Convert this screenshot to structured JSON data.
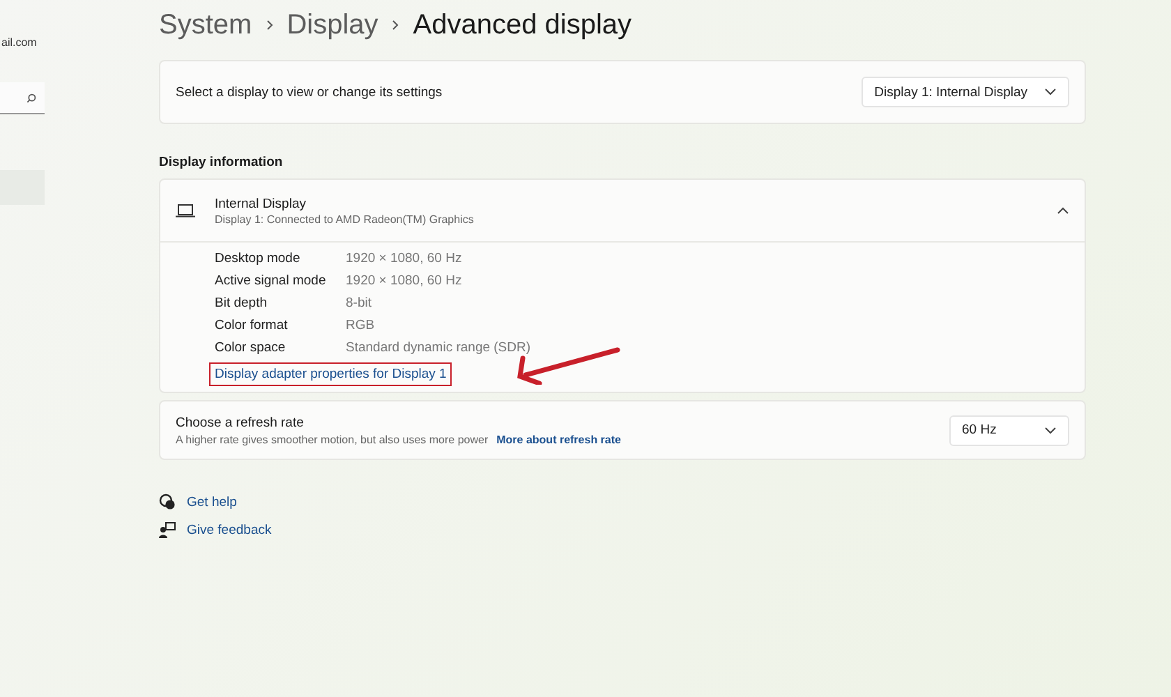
{
  "sidebar": {
    "account_email": "ail.com",
    "items": [
      {
        "selected": true
      }
    ]
  },
  "breadcrumb": [
    "System",
    "Display",
    "Advanced display"
  ],
  "display_select": {
    "label": "Select a display to view or change its settings",
    "value": "Display 1: Internal Display"
  },
  "section_title": "Display information",
  "display_card": {
    "title": "Internal Display",
    "subtitle": "Display 1: Connected to AMD Radeon(TM) Graphics",
    "expanded": true,
    "rows": [
      {
        "label": "Desktop mode",
        "value": "1920 × 1080, 60 Hz"
      },
      {
        "label": "Active signal mode",
        "value": "1920 × 1080, 60 Hz"
      },
      {
        "label": "Bit depth",
        "value": "8-bit"
      },
      {
        "label": "Color format",
        "value": "RGB"
      },
      {
        "label": "Color space",
        "value": "Standard dynamic range (SDR)"
      }
    ],
    "link": {
      "text": "Display adapter properties for Display 1",
      "highlighted": true
    }
  },
  "refresh_rate": {
    "title": "Choose a refresh rate",
    "description": "A higher rate gives smoother motion, but also uses more power",
    "link": "More about refresh rate",
    "value": "60 Hz"
  },
  "footer_links": [
    {
      "kind": "help",
      "text": "Get help"
    },
    {
      "kind": "feedback",
      "text": "Give feedback"
    }
  ]
}
